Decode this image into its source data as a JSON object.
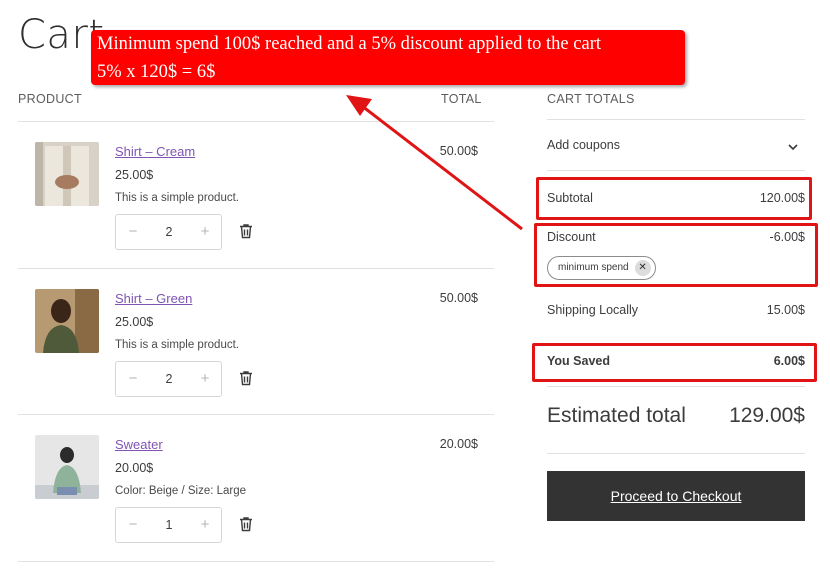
{
  "page": {
    "title": "Cart"
  },
  "table": {
    "product_header": "PRODUCT",
    "total_header": "TOTAL",
    "items": [
      {
        "name": "Shirt – Cream",
        "unit_price": "25.00$",
        "description": "This is a simple product.",
        "quantity": "2",
        "line_total": "50.00$",
        "image": "shirt-cream-photo"
      },
      {
        "name": "Shirt – Green",
        "unit_price": "25.00$",
        "description": "This is a simple product.",
        "quantity": "2",
        "line_total": "50.00$",
        "image": "shirt-green-photo"
      },
      {
        "name": "Sweater",
        "unit_price": "20.00$",
        "description": "Color: Beige / Size: Large",
        "quantity": "1",
        "line_total": "20.00$",
        "image": "sweater-photo"
      }
    ],
    "qty_minus": "−",
    "qty_plus": "+"
  },
  "totals": {
    "heading": "CART TOTALS",
    "coupons_label": "Add coupons",
    "subtotal_label": "Subtotal",
    "subtotal_value": "120.00$",
    "discount_label": "Discount",
    "discount_value": "-6.00$",
    "coupon_chip": "minimum spend",
    "shipping_label": "Shipping Locally",
    "shipping_value": "15.00$",
    "saved_label": "You Saved",
    "saved_value": "6.00$",
    "estimated_label": "Estimated total",
    "estimated_value": "129.00$",
    "checkout_label": "Proceed to Checkout"
  },
  "annotation": {
    "line1": "Minimum spend 100$ reached and a 5% discount applied to the cart",
    "line2": "5% x 120$ = 6$",
    "color": "#ff0000"
  },
  "colors": {
    "link": "#7f54b3",
    "button": "#333333",
    "highlight": "#e01414"
  }
}
